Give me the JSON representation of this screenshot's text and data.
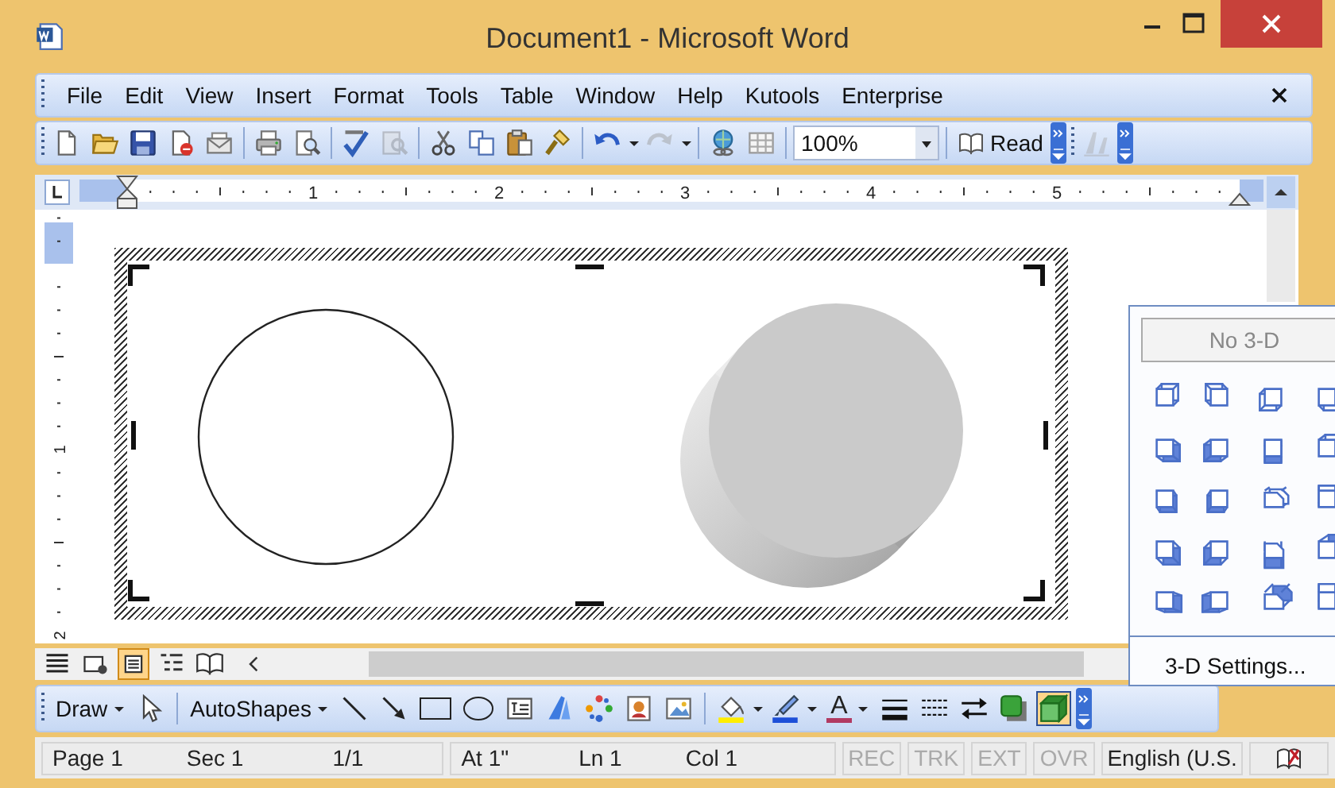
{
  "window": {
    "title": "Document1 - Microsoft Word"
  },
  "menu_bar": {
    "items": [
      "File",
      "Edit",
      "View",
      "Insert",
      "Format",
      "Tools",
      "Table",
      "Window",
      "Help",
      "Kutools",
      "Enterprise"
    ]
  },
  "standard_toolbar": [
    {
      "kind": "new",
      "disabled": false
    },
    {
      "kind": "open",
      "disabled": false
    },
    {
      "kind": "save",
      "disabled": false
    },
    {
      "kind": "permission",
      "disabled": false
    },
    {
      "kind": "email",
      "disabled": false
    },
    {
      "kind": "separator"
    },
    {
      "kind": "print",
      "disabled": false
    },
    {
      "kind": "preview",
      "disabled": false
    },
    {
      "kind": "separator"
    },
    {
      "kind": "spelling",
      "disabled": false
    },
    {
      "kind": "research",
      "disabled": true
    },
    {
      "kind": "separator"
    },
    {
      "kind": "cut",
      "disabled": false
    },
    {
      "kind": "copy",
      "disabled": false
    },
    {
      "kind": "paste",
      "disabled": false
    },
    {
      "kind": "painter",
      "disabled": false
    },
    {
      "kind": "separator"
    },
    {
      "kind": "undo",
      "disabled": false
    },
    {
      "kind": "redo",
      "disabled": true
    },
    {
      "kind": "separator"
    },
    {
      "kind": "hyperlink",
      "disabled": false
    },
    {
      "kind": "table",
      "disabled": false
    },
    {
      "kind": "separator"
    },
    {
      "kind": "zoom",
      "value": "100%"
    },
    {
      "kind": "separator"
    },
    {
      "kind": "read",
      "label": "Read"
    },
    {
      "kind": "chevron"
    },
    {
      "kind": "grip"
    },
    {
      "kind": "styles",
      "disabled": true
    },
    {
      "kind": "chevron"
    }
  ],
  "ruler": {
    "numbers": [
      "1",
      "2",
      "3",
      "4",
      "5"
    ]
  },
  "vertical_ruler": {
    "numbers": [
      "1",
      "2"
    ]
  },
  "canvas": {
    "shapes": [
      {
        "kind": "circle"
      },
      {
        "kind": "cylinder"
      }
    ]
  },
  "view_buttons": [
    {
      "kind": "normal",
      "selected": false
    },
    {
      "kind": "web",
      "selected": false
    },
    {
      "kind": "print",
      "selected": true
    },
    {
      "kind": "outline",
      "selected": false
    },
    {
      "kind": "reading",
      "selected": false
    }
  ],
  "drawing_toolbar": [
    {
      "kind": "menu",
      "label": "Draw"
    },
    {
      "kind": "select",
      "selected": false
    },
    {
      "kind": "separator"
    },
    {
      "kind": "menu",
      "label": "AutoShapes"
    },
    {
      "kind": "line",
      "selected": false
    },
    {
      "kind": "arrow",
      "selected": false
    },
    {
      "kind": "rectangle",
      "selected": false
    },
    {
      "kind": "oval",
      "selected": false
    },
    {
      "kind": "textbox",
      "selected": false
    },
    {
      "kind": "wordart",
      "selected": false
    },
    {
      "kind": "diagram",
      "selected": false
    },
    {
      "kind": "clipart",
      "selected": false
    },
    {
      "kind": "picture",
      "selected": false
    },
    {
      "kind": "separator"
    },
    {
      "kind": "fill",
      "selected": false
    },
    {
      "kind": "linecolor",
      "selected": false
    },
    {
      "kind": "fontcolor",
      "label": "A"
    },
    {
      "kind": "linestyle",
      "selected": false
    },
    {
      "kind": "dashstyle",
      "selected": false
    },
    {
      "kind": "arrowstyle",
      "selected": false
    },
    {
      "kind": "shadow",
      "selected": false
    },
    {
      "kind": "threed",
      "selected": true
    },
    {
      "kind": "chevron"
    }
  ],
  "status_bar": {
    "groups": [
      [
        "Page 1",
        "Sec 1",
        "1/1"
      ],
      [
        "At 1\"",
        "Ln 1",
        "Col 1"
      ]
    ],
    "modes": [
      {
        "label": "REC",
        "disabled": true
      },
      {
        "label": "TRK",
        "disabled": true
      },
      {
        "label": "EXT",
        "disabled": true
      },
      {
        "label": "OVR",
        "disabled": true
      }
    ],
    "language": "English (U.S."
  },
  "three_d_menu": {
    "none_option": "No 3-D",
    "settings": "3-D Settings..."
  }
}
